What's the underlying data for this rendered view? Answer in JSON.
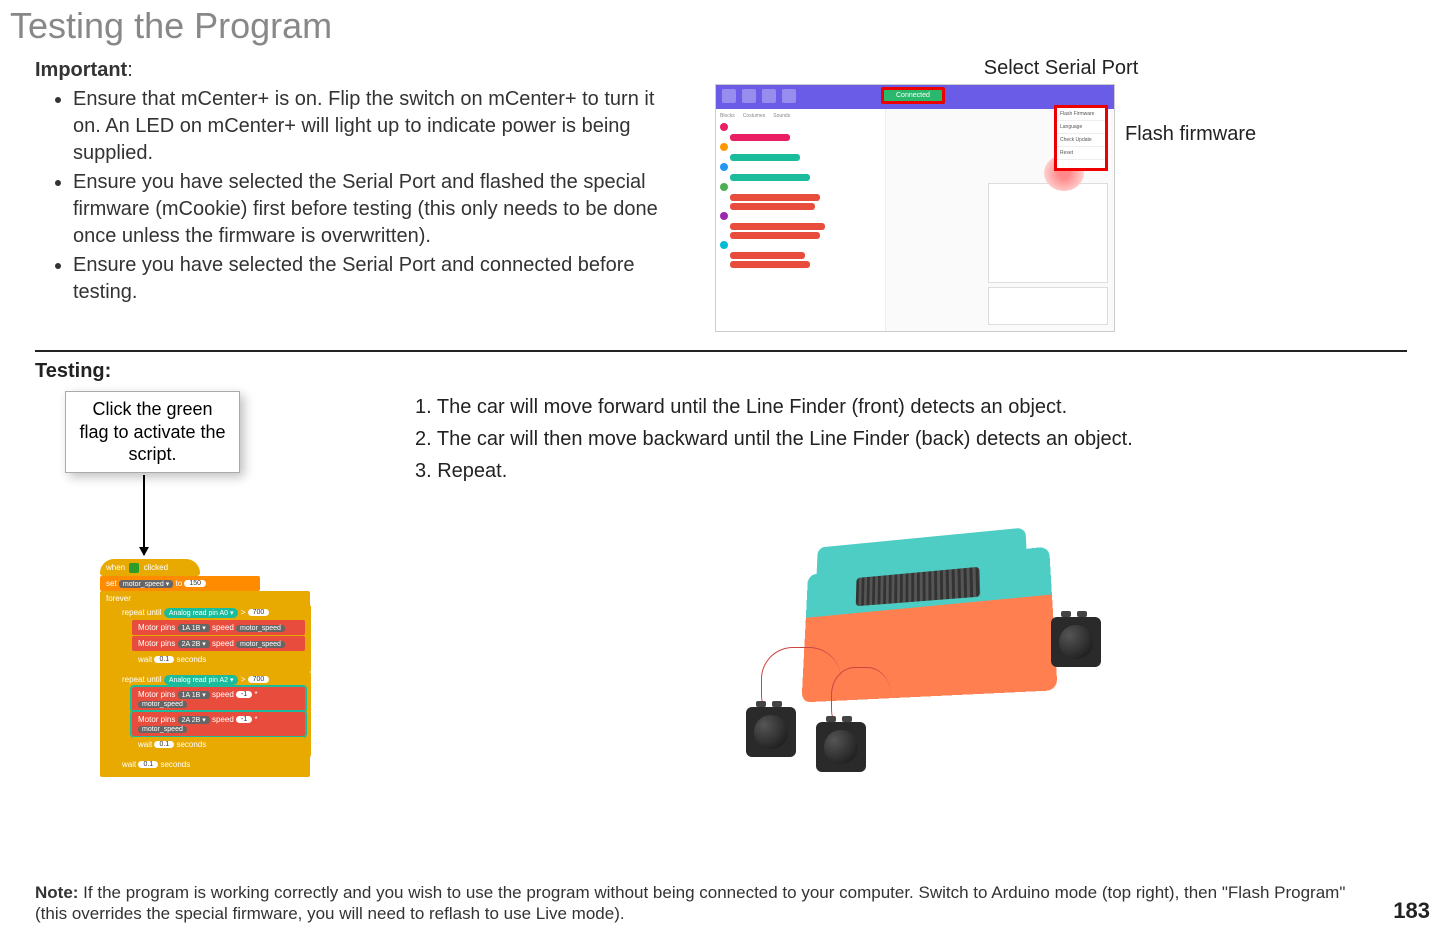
{
  "page_title": "Testing the Program",
  "important": {
    "label": "Important",
    "colon": ":",
    "items": [
      "Ensure that mCenter+ is on. Flip the switch on mCenter+ to turn it on. An LED on mCenter+ will light up to indicate power is being supplied.",
      "Ensure you have selected the Serial Port and flashed the special firmware (mCookie) first before testing (this only needs to be done once unless the firmware is overwritten).",
      "Ensure you have selected the Serial Port and connected before testing."
    ]
  },
  "screenshot": {
    "top_label": "Select Serial Port",
    "side_label": "Flash firmware",
    "connected_text": "Connected",
    "menu_items": [
      "Flash Firmware",
      "Language",
      "Check Update",
      "Reset"
    ]
  },
  "testing": {
    "title": "Testing:",
    "callout": "Click the green flag to activate the script.",
    "steps": [
      "1. The car will move forward until the Line Finder (front) detects an object.",
      "2. The car will then move backward until the Line Finder (back) detects an object.",
      "3. Repeat."
    ],
    "script": {
      "hat_pre": "when",
      "hat_post": "clicked",
      "set_var": "set",
      "var_name": "motor_speed ▾",
      "set_to": "to",
      "set_val": "150",
      "forever": "forever",
      "repeat_until": "repeat until",
      "analog_read": "Analog read pin",
      "pin_a0": "A0 ▾",
      "gt": ">",
      "thresh": "700",
      "motor_pins": "Motor pins",
      "pair_1a1b": "1A 1B ▾",
      "pair_2a2b": "2A 2B ▾",
      "speed": "speed",
      "ms": "motor_speed",
      "neg1": "-1",
      "times": "*",
      "wait": "wait",
      "wait_val": "0.1",
      "seconds": "seconds",
      "pin_a2": "A2 ▾"
    }
  },
  "note": {
    "bold": "Note:",
    "text": " If the program is working correctly and you wish to use the program without being connected to your computer. Switch to Arduino mode (top right), then \"Flash Program\" (this overrides the special firmware, you will need to reflash to use Live mode)."
  },
  "page_number": "183"
}
